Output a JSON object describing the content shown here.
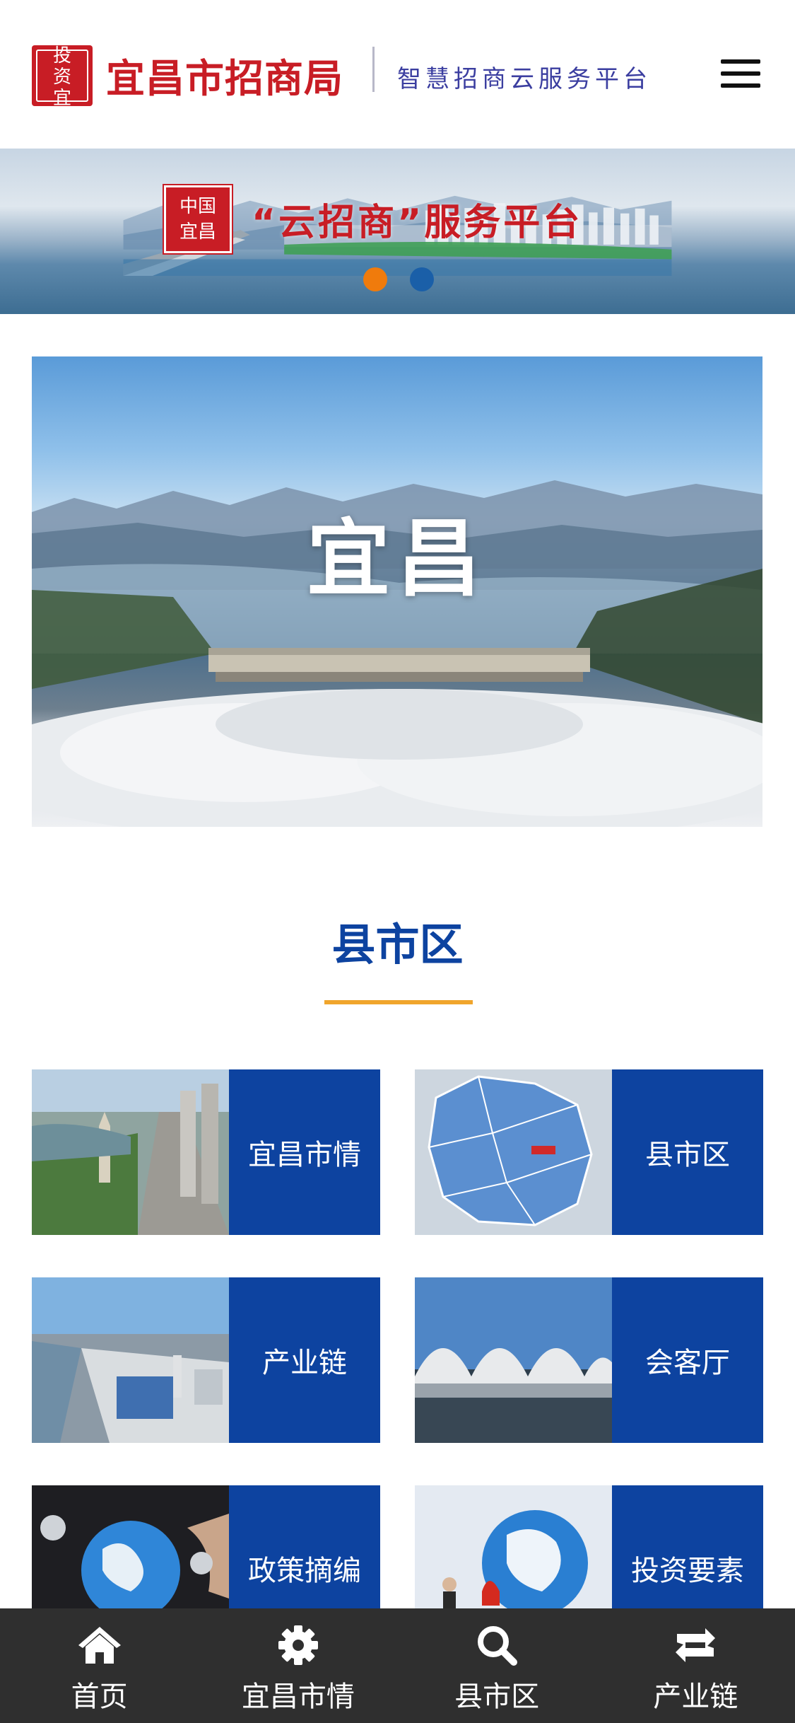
{
  "header": {
    "seal_text": "投资宜昌",
    "bureau_name": "宜昌市招商局",
    "platform_name": "智慧招商云服务平台",
    "menu_icon": "hamburger-menu-icon"
  },
  "banner": {
    "seal_text": "中国宜昌",
    "title": "“云招商”服务平台",
    "slides_total": 2,
    "active_slide": 1
  },
  "hero": {
    "title": "宜昌"
  },
  "section": {
    "title": "县市区"
  },
  "cards": [
    {
      "label": "宜昌市情",
      "image": "city-pagoda-road-photo"
    },
    {
      "label": "县市区",
      "image": "district-map-image"
    },
    {
      "label": "产业链",
      "image": "industrial-port-photo"
    },
    {
      "label": "会客厅",
      "image": "stadium-photo"
    },
    {
      "label": "政策摘编",
      "image": "globe-hands-image"
    },
    {
      "label": "投资要素",
      "image": "globe-businessman-image"
    }
  ],
  "bottom_nav": [
    {
      "label": "首页",
      "icon": "home-icon"
    },
    {
      "label": "宜昌市情",
      "icon": "gear-icon"
    },
    {
      "label": "县市区",
      "icon": "search-icon"
    },
    {
      "label": "产业链",
      "icon": "retweet-icon"
    }
  ],
  "colors": {
    "brand_red": "#c81d25",
    "brand_blue": "#0d43a0",
    "accent_orange": "#f0a52c",
    "nav_bg": "#2f2f2f"
  }
}
